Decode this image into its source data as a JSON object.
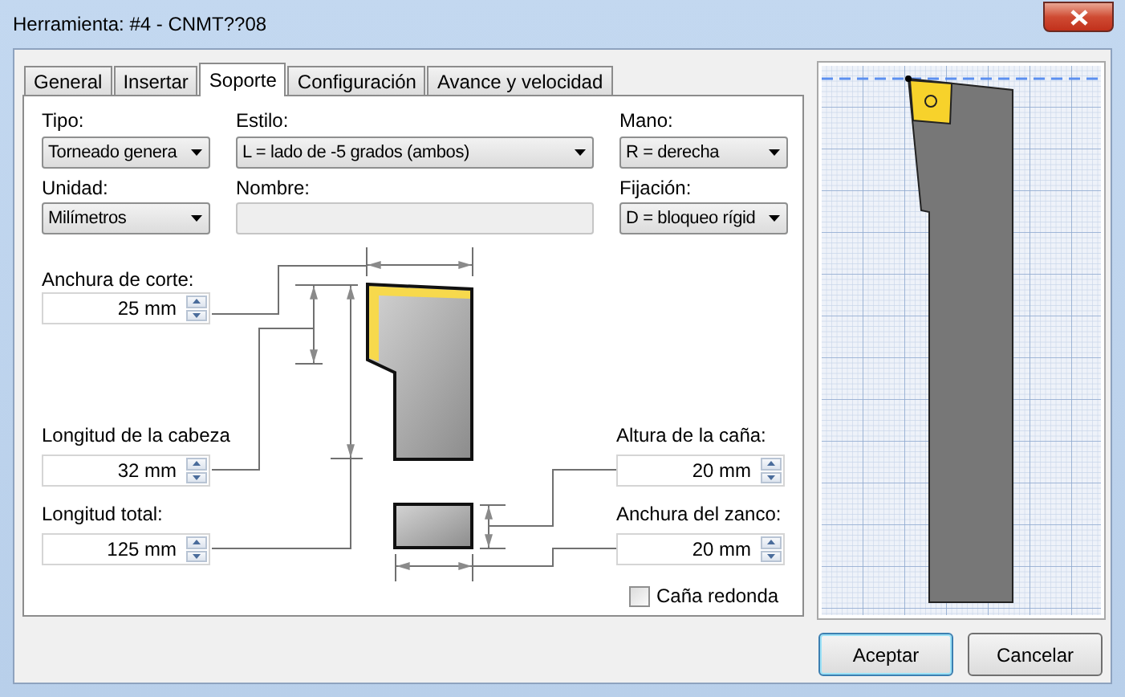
{
  "window": {
    "title": "Herramienta: #4 - CNMT??08"
  },
  "tabs": [
    {
      "label": "General",
      "selected": false
    },
    {
      "label": "Insertar",
      "selected": false
    },
    {
      "label": "Soporte",
      "selected": true
    },
    {
      "label": "Configuración",
      "selected": false
    },
    {
      "label": "Avance y velocidad",
      "selected": false
    }
  ],
  "fields": [
    {
      "label": "Tipo:",
      "kind": "select",
      "value": "Torneado genera",
      "disabled": false
    },
    {
      "label": "Estilo:",
      "kind": "select",
      "value": "L = lado de -5 grados (ambos)",
      "disabled": false
    },
    {
      "label": "Mano:",
      "kind": "select",
      "value": "R = derecha",
      "disabled": false
    },
    {
      "label": "Unidad:",
      "kind": "select",
      "value": "Milímetros",
      "disabled": false
    },
    {
      "label": "Nombre:",
      "kind": "text",
      "disabled": true
    },
    {
      "label": "Fijación:",
      "kind": "select",
      "value": "D = bloqueo rígid",
      "disabled": false
    }
  ],
  "left_dimensions": [
    {
      "label": "Anchura de corte:",
      "value": "25 mm"
    },
    {
      "label": "Longitud de la cabeza",
      "value": "32 mm"
    },
    {
      "label": "Longitud total:",
      "value": "125 mm"
    }
  ],
  "right_dimensions": [
    {
      "label": "Altura de la caña:",
      "value": "20 mm"
    },
    {
      "label": "Anchura del zanco:",
      "value": "20 mm"
    }
  ],
  "checkbox": {
    "label": "Caña redonda",
    "checked": false
  },
  "buttons": [
    {
      "label": "Aceptar",
      "default": true
    },
    {
      "label": "Cancelar",
      "default": false
    }
  ]
}
